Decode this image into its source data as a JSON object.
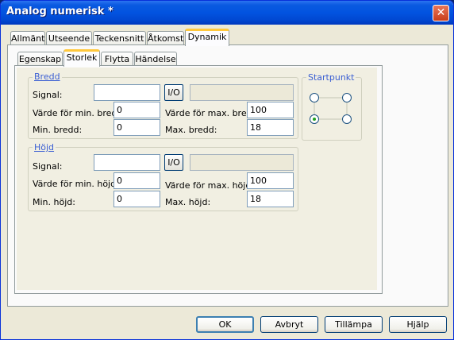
{
  "window": {
    "title": "Analog numerisk *",
    "close_glyph": "✕"
  },
  "outer_tabs": [
    "Allmänt",
    "Utseende",
    "Teckensnitt",
    "Åtkomst",
    "Dynamik"
  ],
  "inner_tabs": [
    "Egenskap",
    "Storlek",
    "Flytta",
    "Händelse"
  ],
  "bredd": {
    "legend": "Bredd",
    "signal_label": "Signal:",
    "signal_value": "",
    "io_label": "I/O",
    "io_display": "",
    "min_value_label": "Värde för min. bredd:",
    "min_value": "0",
    "max_value_label": "Värde för max. bredd:",
    "max_value": "100",
    "min_size_label": "Min. bredd:",
    "min_size": "0",
    "max_size_label": "Max. bredd:",
    "max_size": "18"
  },
  "hojd": {
    "legend": "Höjd",
    "signal_label": "Signal:",
    "signal_value": "",
    "io_label": "I/O",
    "io_display": "",
    "min_value_label": "Värde för min. höjd:",
    "min_value": "0",
    "max_value_label": "Värde för max. höjd:",
    "max_value": "100",
    "min_size_label": "Min. höjd:",
    "min_size": "0",
    "max_size_label": "Max. höjd:",
    "max_size": "18"
  },
  "startpunkt": {
    "legend": "Startpunkt",
    "selected": "bottom-left"
  },
  "buttons": {
    "ok": "OK",
    "cancel": "Avbryt",
    "apply": "Tillämpa",
    "help": "Hjälp"
  }
}
